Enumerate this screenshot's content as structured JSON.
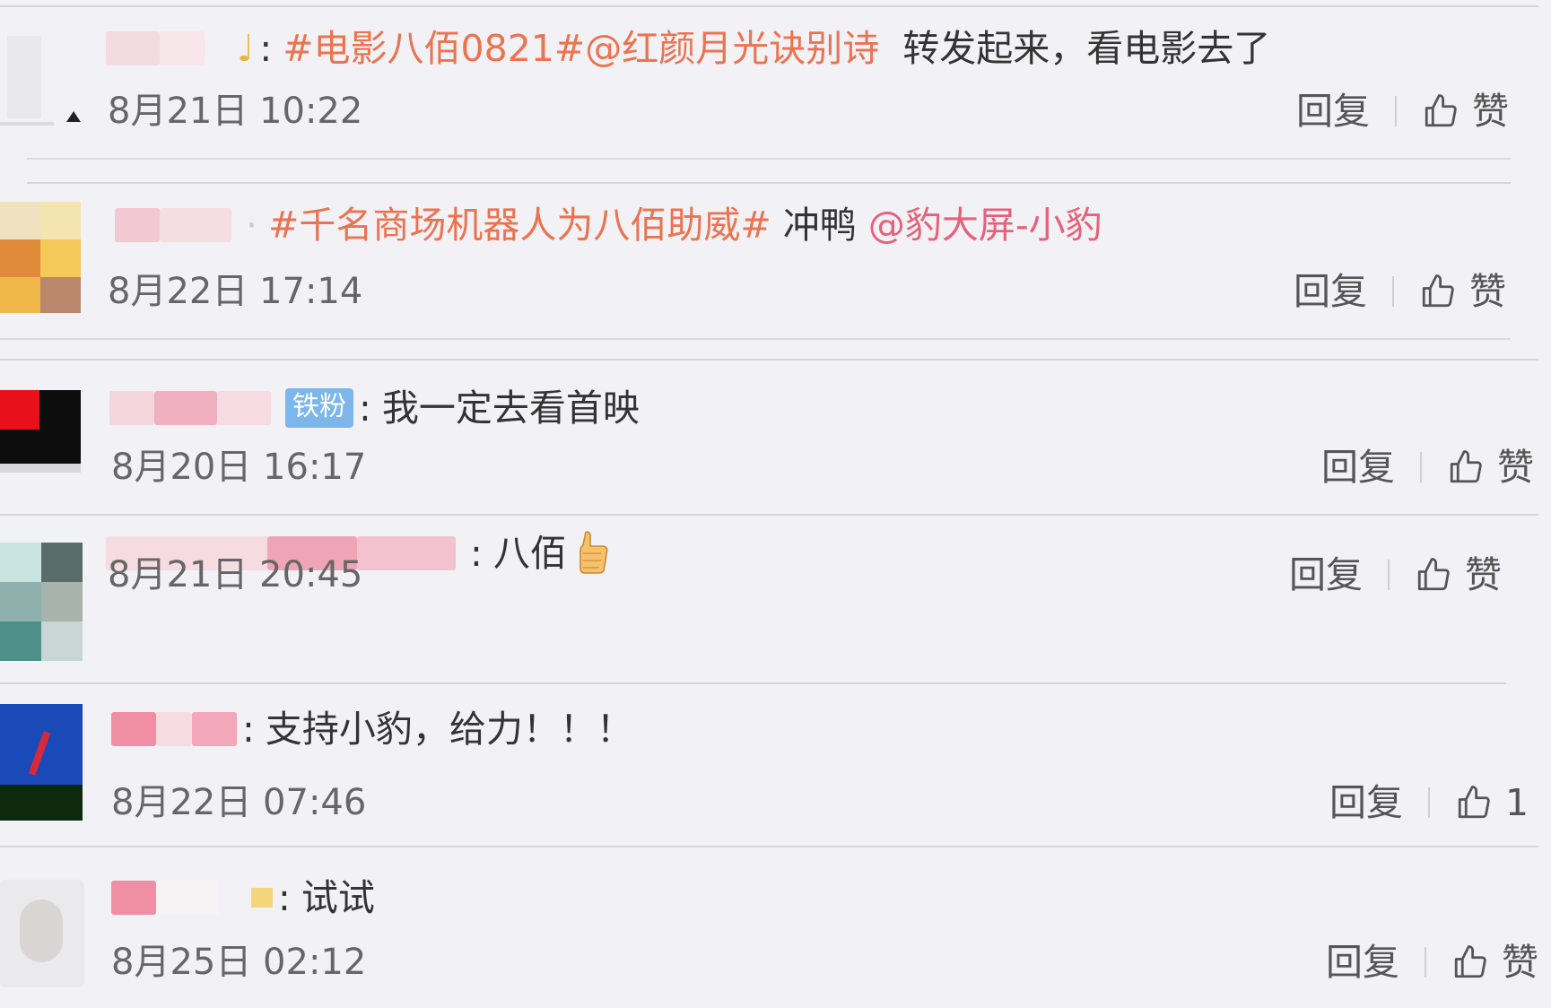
{
  "comments": [
    {
      "segments": [
        {
          "kind": "topic",
          "text": "#电影八佰0821#@红颜月光诀别诗"
        },
        {
          "kind": "text",
          "text": "  转发起来，看电影去了"
        }
      ],
      "time": "8月21日 10:22",
      "reply": "回复",
      "like": "赞"
    },
    {
      "segments": [
        {
          "kind": "topic",
          "text": "#千名商场机器人为八佰助威#"
        },
        {
          "kind": "text",
          "text": " 冲鸭 "
        },
        {
          "kind": "mention",
          "text": "@豹大屏-小豹"
        }
      ],
      "time": "8月22日 17:14",
      "reply": "回复",
      "like": "赞"
    },
    {
      "badge": "铁粉",
      "segments": [
        {
          "kind": "text",
          "text": "我一定去看首映"
        }
      ],
      "time": "8月20日 16:17",
      "reply": "回复",
      "like": "赞"
    },
    {
      "segments": [
        {
          "kind": "text",
          "text": "八佰"
        }
      ],
      "emoji": "thumbs-up-emoji",
      "time": "8月21日 20:45",
      "reply": "回复",
      "like": "赞"
    },
    {
      "segments": [
        {
          "kind": "text",
          "text": "支持小豹，给力！！！"
        }
      ],
      "time": "8月22日 07:46",
      "reply": "回复",
      "like": "1"
    },
    {
      "segments": [
        {
          "kind": "text",
          "text": "试试"
        }
      ],
      "time": "8月25日 02:12",
      "reply": "回复",
      "like": "赞"
    }
  ],
  "icons": {
    "like": "thumbs-up-outline-icon"
  },
  "colors": {
    "topic": "#eb7350",
    "mention": "#e8607a",
    "badge": "#7cb6ea",
    "background": "#f2f1f5"
  }
}
